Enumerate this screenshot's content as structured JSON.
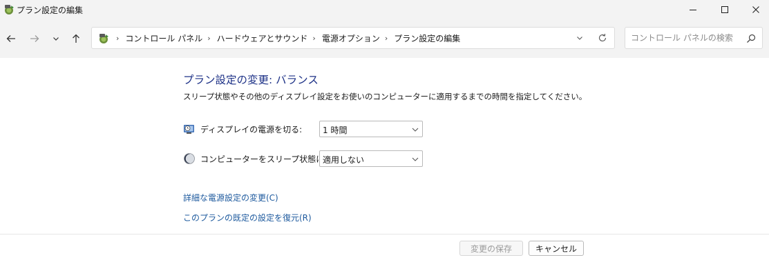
{
  "window": {
    "title": "プラン設定の編集",
    "icon": "power-options-icon"
  },
  "address_bar": {
    "breadcrumbs": [
      {
        "label": "コントロール パネル"
      },
      {
        "label": "ハードウェアとサウンド"
      },
      {
        "label": "電源オプション"
      },
      {
        "label": "プラン設定の編集"
      }
    ],
    "separator": "›"
  },
  "search": {
    "placeholder": "コントロール パネルの検索",
    "value": ""
  },
  "main": {
    "heading": "プラン設定の変更: バランス",
    "description": "スリープ状態やその他のディスプレイ設定をお使いのコンピューターに適用するまでの時間を指定してください。",
    "settings": [
      {
        "label": "ディスプレイの電源を切る:",
        "value": "1 時間",
        "icon": "display-clock-icon"
      },
      {
        "label": "コンピューターをスリープ状態にする:",
        "value": "適用しない",
        "icon": "moon-sleep-icon"
      }
    ],
    "links": [
      {
        "label": "詳細な電源設定の変更(C)"
      },
      {
        "label": "このプランの既定の設定を復元(R)"
      }
    ]
  },
  "footer": {
    "save_label": "変更の保存",
    "cancel_label": "キャンセル"
  },
  "colors": {
    "heading": "#1e3287",
    "link": "#1e5a9e",
    "chrome": "#f3f3f3"
  }
}
